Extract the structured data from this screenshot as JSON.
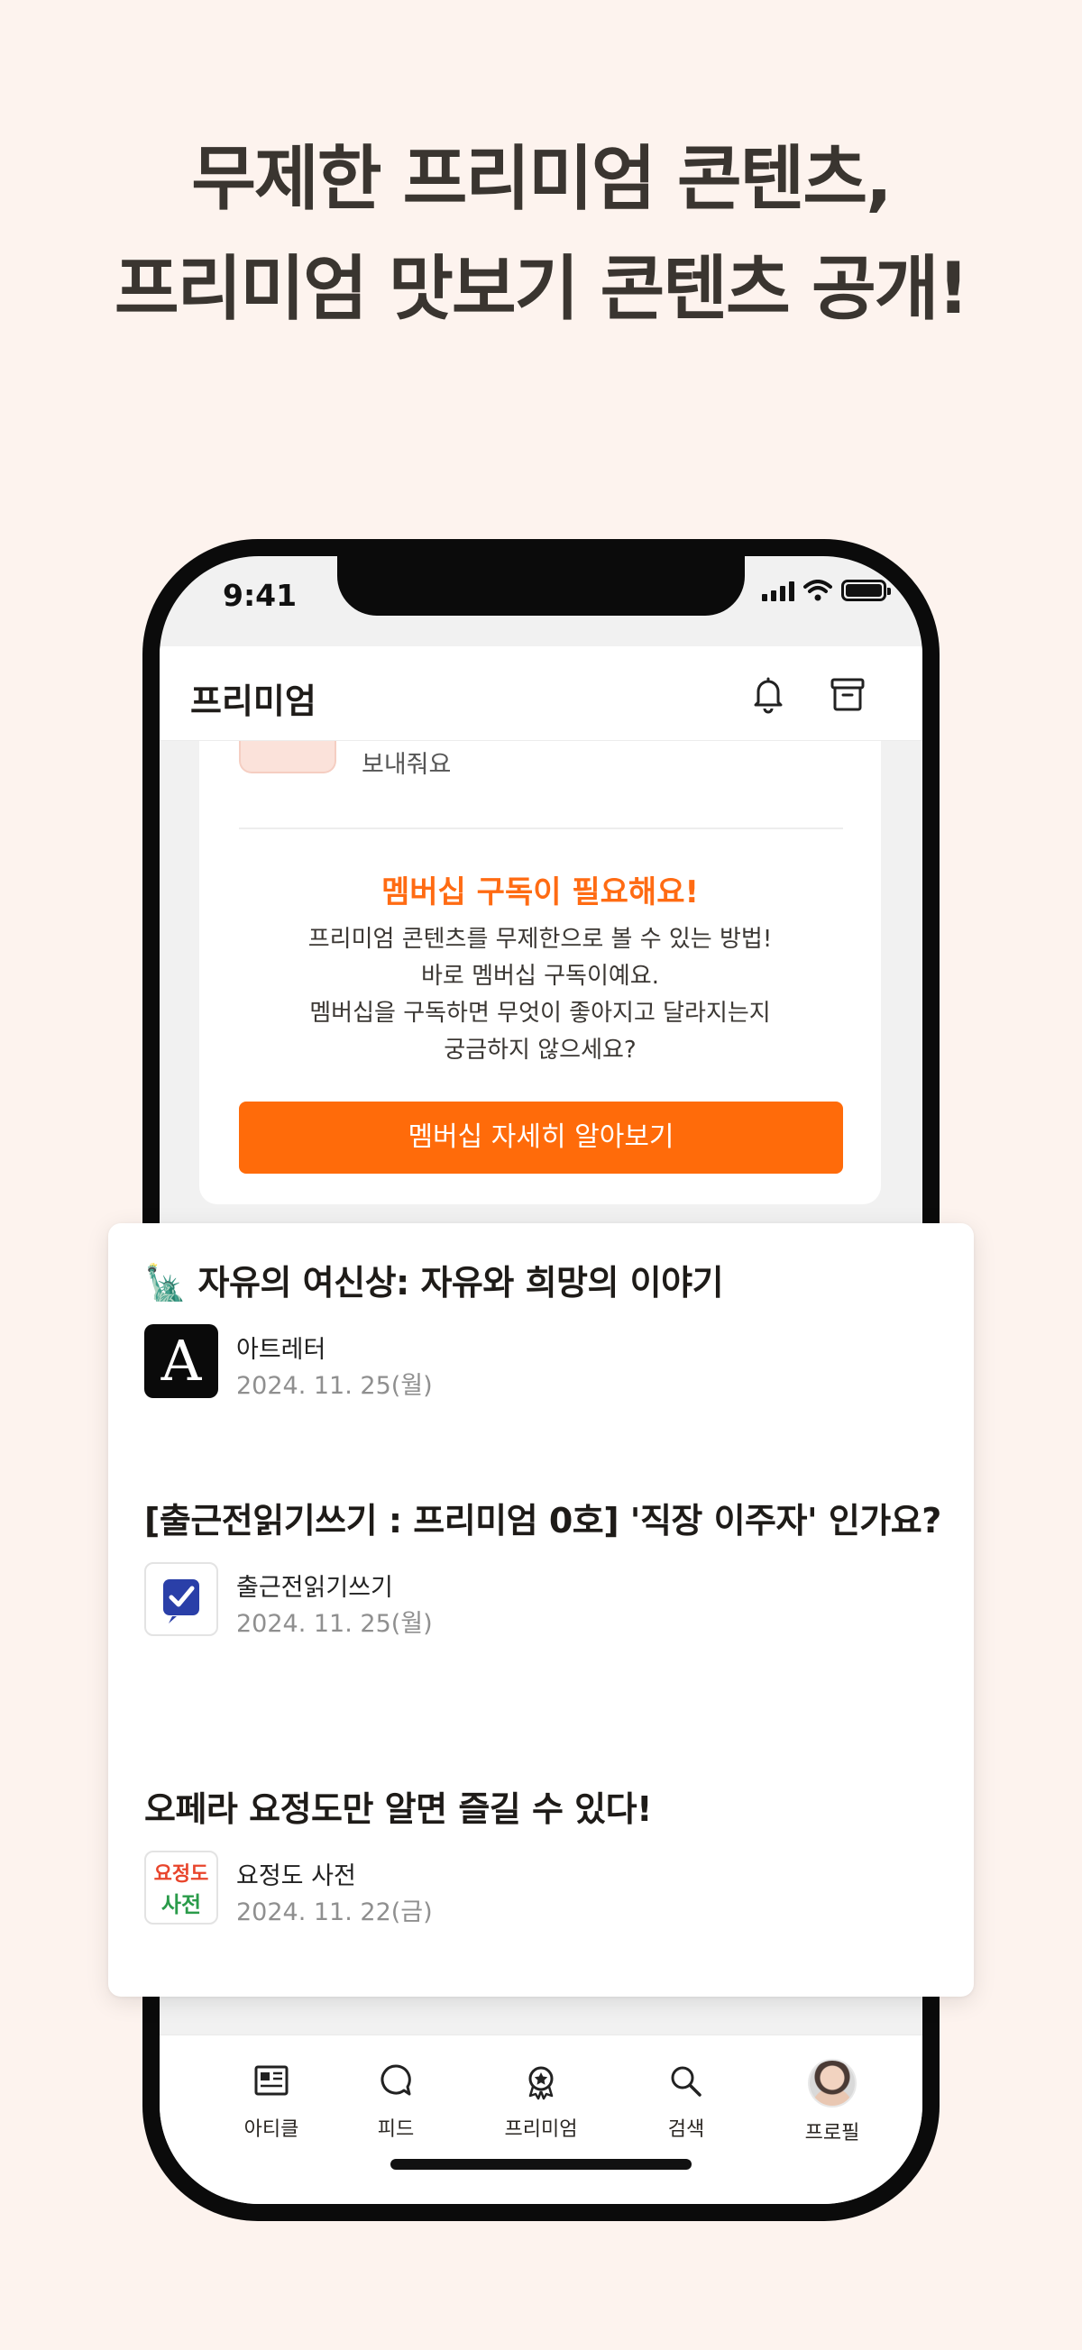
{
  "headline": {
    "line1": "무제한 프리미엄 콘텐츠,",
    "line2": "프리미엄 맛보기 콘텐츠 공개!"
  },
  "status_bar": {
    "time": "9:41"
  },
  "app_bar": {
    "title": "프리미엄",
    "icons": [
      "bell-icon",
      "archive-icon"
    ]
  },
  "membership_card": {
    "peek_text": "보내줘요",
    "title": "멤버십 구독이 필요해요!",
    "description": [
      "프리미엄 콘텐츠를 무제한으로 볼 수 있는 방법!",
      "바로 멤버십 구독이예요.",
      "멤버십을 구독하면 무엇이 좋아지고 달라지는지",
      "궁금하지 않으세요?"
    ],
    "cta_label": "멤버십 자세히 알아보기"
  },
  "articles": [
    {
      "title": "🗽 자유의 여신상: 자유와 희망의 이야기",
      "publisher": "아트레터",
      "date": "2024. 11. 25(월)",
      "logo": "A"
    },
    {
      "title": "[출근전읽기쓰기 : 프리미엄 0호] '직장 이주자' 인가요?",
      "publisher": "출근전읽기쓰기",
      "date": "2024. 11. 25(월)",
      "logo": "checkbox-logo"
    },
    {
      "title": "오페라 요정도만 알면 즐길 수 있다!",
      "publisher": "요정도 사전",
      "date": "2024. 11. 22(금)",
      "logo_top": "요정도",
      "logo_bottom": "사전"
    }
  ],
  "tab_bar": {
    "tabs": [
      {
        "label": "아티클",
        "icon": "article-icon"
      },
      {
        "label": "피드",
        "icon": "feed-bubble-icon"
      },
      {
        "label": "프리미엄",
        "icon": "premium-badge-icon"
      },
      {
        "label": "검색",
        "icon": "search-icon"
      },
      {
        "label": "프로필",
        "icon": "avatar"
      }
    ]
  },
  "colors": {
    "accent": "#ff6b0a",
    "background": "#fdf3ee"
  }
}
